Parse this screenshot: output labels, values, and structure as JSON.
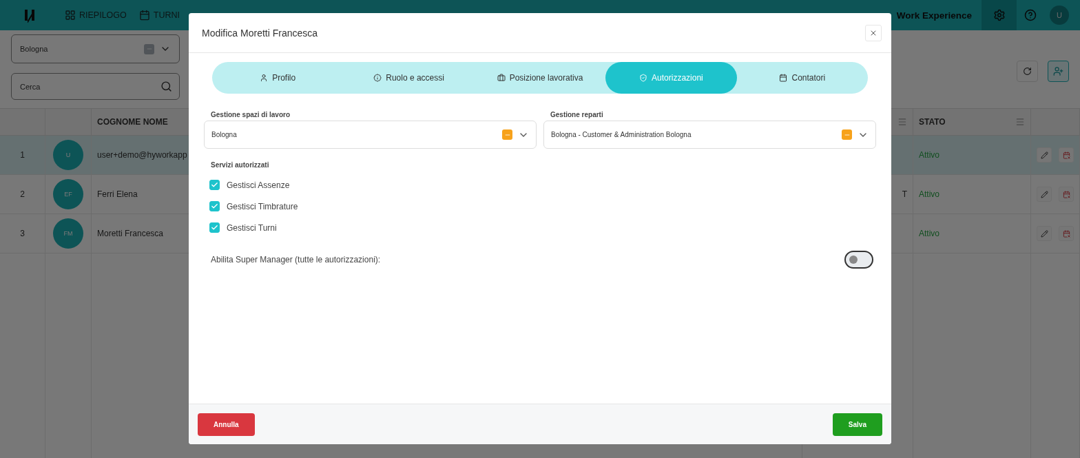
{
  "header": {
    "nav": [
      {
        "label": "RIEPILOGO"
      },
      {
        "label": "TURNI"
      }
    ],
    "app_title": "Work Experience",
    "avatar": "U"
  },
  "filters": {
    "location": "Bologna",
    "search_placeholder": "Cerca"
  },
  "table": {
    "columns": [
      "COGNOME NOME",
      "STATO"
    ],
    "rows": [
      {
        "index": "1",
        "initials": "U",
        "name": "user+demo@hyworkapp",
        "column_4": "",
        "status": "Attivo",
        "selected": true
      },
      {
        "index": "2",
        "initials": "EF",
        "name": "Ferri Elena",
        "column_4": "T",
        "status": "Attivo",
        "selected": false
      },
      {
        "index": "3",
        "initials": "FM",
        "name": "Moretti Francesca",
        "column_4": "",
        "status": "Attivo",
        "selected": false
      }
    ]
  },
  "modal": {
    "title": "Modifica Moretti Francesca",
    "tabs": [
      {
        "label": "Profilo",
        "selected": false
      },
      {
        "label": "Ruolo e accessi",
        "selected": false
      },
      {
        "label": "Posizione lavorativa",
        "selected": false
      },
      {
        "label": "Autorizzazioni",
        "selected": true
      },
      {
        "label": "Contatori",
        "selected": false
      }
    ],
    "fields": [
      {
        "label": "Gestione spazi di lavoro",
        "value": "Bologna"
      },
      {
        "label": "Gestione reparti",
        "value": "Bologna - Customer & Administration Bologna"
      }
    ],
    "services": {
      "label": "Servizi autorizzati",
      "items": [
        {
          "label": "Gestisci Assenze",
          "checked": true
        },
        {
          "label": "Gestisci Timbrature",
          "checked": true
        },
        {
          "label": "Gestisci Turni",
          "checked": true
        }
      ]
    },
    "super_manager": {
      "label": "Abilita Super Manager (tutte le autorizzazioni):",
      "on": false
    },
    "buttons": {
      "cancel": "Annulla",
      "save": "Salva"
    }
  }
}
